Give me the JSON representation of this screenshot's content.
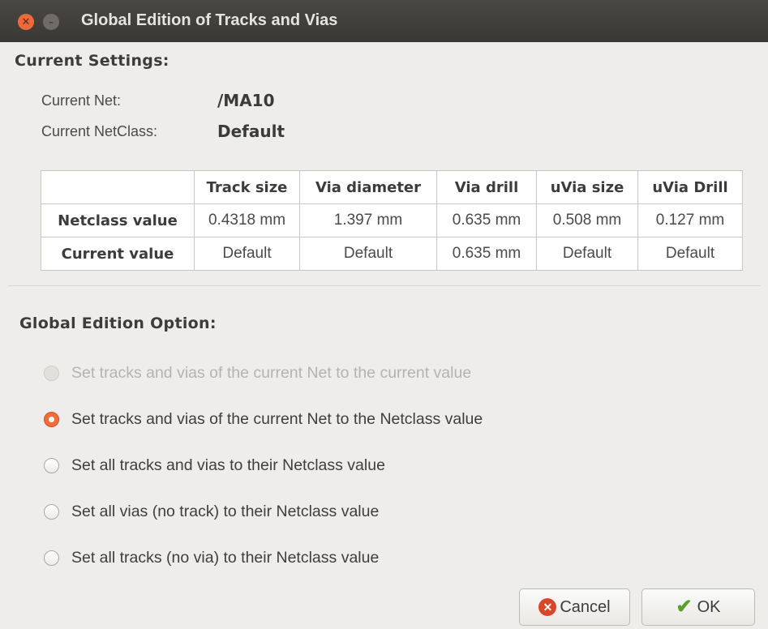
{
  "window": {
    "title": "Global Edition of Tracks and Vias",
    "close_glyph": "✕",
    "minimize_glyph": "–"
  },
  "current_settings": {
    "heading": "Current Settings:",
    "net_label": "Current Net:",
    "net_value": "/MA10",
    "netclass_label": "Current NetClass:",
    "netclass_value": "Default"
  },
  "table": {
    "columns": [
      "",
      "Track size",
      "Via diameter",
      "Via drill",
      "uVia size",
      "uVia Drill"
    ],
    "rows": [
      {
        "label": "Netclass value",
        "cells": [
          "0.4318 mm",
          "1.397 mm",
          "0.635 mm",
          "0.508 mm",
          "0.127 mm"
        ]
      },
      {
        "label": "Current value",
        "cells": [
          "Default",
          "Default",
          "0.635 mm",
          "Default",
          "Default"
        ]
      }
    ]
  },
  "global_edition": {
    "heading": "Global Edition Option:",
    "options": [
      {
        "label": "Set tracks and vias of the current Net to the current value",
        "state": "disabled"
      },
      {
        "label": "Set tracks and vias of the current Net to the Netclass value",
        "state": "checked"
      },
      {
        "label": "Set all tracks and vias to their Netclass value",
        "state": "unchecked"
      },
      {
        "label": "Set all vias (no track) to their Netclass value",
        "state": "unchecked"
      },
      {
        "label": "Set all tracks (no via) to their Netclass value",
        "state": "unchecked"
      }
    ]
  },
  "buttons": {
    "cancel_label": "Cancel",
    "cancel_icon": "cancel-icon",
    "ok_label": "OK",
    "ok_icon": "checkmark-icon"
  },
  "colors": {
    "titlebar": "#3c3b37",
    "accent": "#f26b3a",
    "window_bg": "#efedeb"
  }
}
